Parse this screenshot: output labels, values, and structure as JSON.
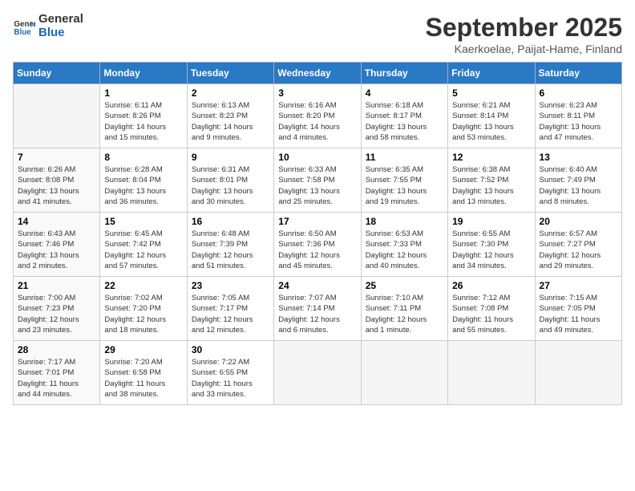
{
  "header": {
    "logo_line1": "General",
    "logo_line2": "Blue",
    "month_title": "September 2025",
    "subtitle": "Kaerkoelae, Paijat-Hame, Finland"
  },
  "days_of_week": [
    "Sunday",
    "Monday",
    "Tuesday",
    "Wednesday",
    "Thursday",
    "Friday",
    "Saturday"
  ],
  "weeks": [
    [
      {
        "day": "",
        "info": ""
      },
      {
        "day": "1",
        "info": "Sunrise: 6:11 AM\nSunset: 8:26 PM\nDaylight: 14 hours\nand 15 minutes."
      },
      {
        "day": "2",
        "info": "Sunrise: 6:13 AM\nSunset: 8:23 PM\nDaylight: 14 hours\nand 9 minutes."
      },
      {
        "day": "3",
        "info": "Sunrise: 6:16 AM\nSunset: 8:20 PM\nDaylight: 14 hours\nand 4 minutes."
      },
      {
        "day": "4",
        "info": "Sunrise: 6:18 AM\nSunset: 8:17 PM\nDaylight: 13 hours\nand 58 minutes."
      },
      {
        "day": "5",
        "info": "Sunrise: 6:21 AM\nSunset: 8:14 PM\nDaylight: 13 hours\nand 53 minutes."
      },
      {
        "day": "6",
        "info": "Sunrise: 6:23 AM\nSunset: 8:11 PM\nDaylight: 13 hours\nand 47 minutes."
      }
    ],
    [
      {
        "day": "7",
        "info": "Sunrise: 6:26 AM\nSunset: 8:08 PM\nDaylight: 13 hours\nand 41 minutes."
      },
      {
        "day": "8",
        "info": "Sunrise: 6:28 AM\nSunset: 8:04 PM\nDaylight: 13 hours\nand 36 minutes."
      },
      {
        "day": "9",
        "info": "Sunrise: 6:31 AM\nSunset: 8:01 PM\nDaylight: 13 hours\nand 30 minutes."
      },
      {
        "day": "10",
        "info": "Sunrise: 6:33 AM\nSunset: 7:58 PM\nDaylight: 13 hours\nand 25 minutes."
      },
      {
        "day": "11",
        "info": "Sunrise: 6:35 AM\nSunset: 7:55 PM\nDaylight: 13 hours\nand 19 minutes."
      },
      {
        "day": "12",
        "info": "Sunrise: 6:38 AM\nSunset: 7:52 PM\nDaylight: 13 hours\nand 13 minutes."
      },
      {
        "day": "13",
        "info": "Sunrise: 6:40 AM\nSunset: 7:49 PM\nDaylight: 13 hours\nand 8 minutes."
      }
    ],
    [
      {
        "day": "14",
        "info": "Sunrise: 6:43 AM\nSunset: 7:46 PM\nDaylight: 13 hours\nand 2 minutes."
      },
      {
        "day": "15",
        "info": "Sunrise: 6:45 AM\nSunset: 7:42 PM\nDaylight: 12 hours\nand 57 minutes."
      },
      {
        "day": "16",
        "info": "Sunrise: 6:48 AM\nSunset: 7:39 PM\nDaylight: 12 hours\nand 51 minutes."
      },
      {
        "day": "17",
        "info": "Sunrise: 6:50 AM\nSunset: 7:36 PM\nDaylight: 12 hours\nand 45 minutes."
      },
      {
        "day": "18",
        "info": "Sunrise: 6:53 AM\nSunset: 7:33 PM\nDaylight: 12 hours\nand 40 minutes."
      },
      {
        "day": "19",
        "info": "Sunrise: 6:55 AM\nSunset: 7:30 PM\nDaylight: 12 hours\nand 34 minutes."
      },
      {
        "day": "20",
        "info": "Sunrise: 6:57 AM\nSunset: 7:27 PM\nDaylight: 12 hours\nand 29 minutes."
      }
    ],
    [
      {
        "day": "21",
        "info": "Sunrise: 7:00 AM\nSunset: 7:23 PM\nDaylight: 12 hours\nand 23 minutes."
      },
      {
        "day": "22",
        "info": "Sunrise: 7:02 AM\nSunset: 7:20 PM\nDaylight: 12 hours\nand 18 minutes."
      },
      {
        "day": "23",
        "info": "Sunrise: 7:05 AM\nSunset: 7:17 PM\nDaylight: 12 hours\nand 12 minutes."
      },
      {
        "day": "24",
        "info": "Sunrise: 7:07 AM\nSunset: 7:14 PM\nDaylight: 12 hours\nand 6 minutes."
      },
      {
        "day": "25",
        "info": "Sunrise: 7:10 AM\nSunset: 7:11 PM\nDaylight: 12 hours\nand 1 minute."
      },
      {
        "day": "26",
        "info": "Sunrise: 7:12 AM\nSunset: 7:08 PM\nDaylight: 11 hours\nand 55 minutes."
      },
      {
        "day": "27",
        "info": "Sunrise: 7:15 AM\nSunset: 7:05 PM\nDaylight: 11 hours\nand 49 minutes."
      }
    ],
    [
      {
        "day": "28",
        "info": "Sunrise: 7:17 AM\nSunset: 7:01 PM\nDaylight: 11 hours\nand 44 minutes."
      },
      {
        "day": "29",
        "info": "Sunrise: 7:20 AM\nSunset: 6:58 PM\nDaylight: 11 hours\nand 38 minutes."
      },
      {
        "day": "30",
        "info": "Sunrise: 7:22 AM\nSunset: 6:55 PM\nDaylight: 11 hours\nand 33 minutes."
      },
      {
        "day": "",
        "info": ""
      },
      {
        "day": "",
        "info": ""
      },
      {
        "day": "",
        "info": ""
      },
      {
        "day": "",
        "info": ""
      }
    ]
  ]
}
